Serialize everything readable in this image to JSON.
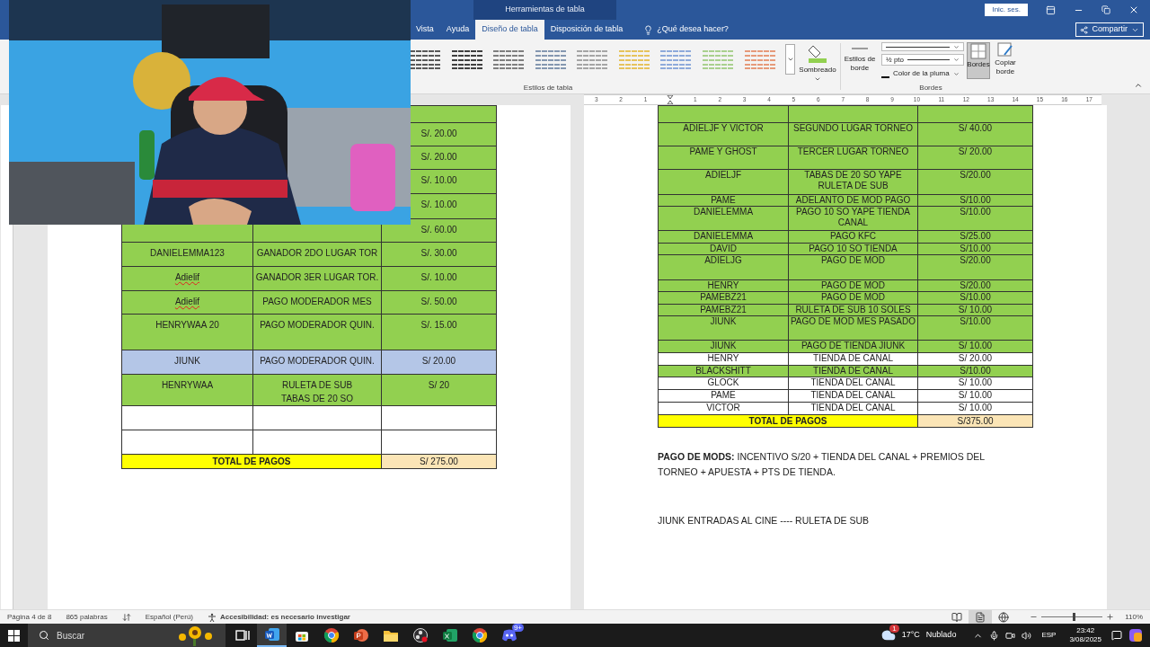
{
  "title_bar": {
    "context_label": "Herramientas de tabla",
    "sign_in": "Inic. ses."
  },
  "tabs": [
    {
      "label": "Vista",
      "selected": false
    },
    {
      "label": "Ayuda",
      "selected": false
    },
    {
      "label": "Diseño de tabla",
      "selected": true
    },
    {
      "label": "Disposición de tabla",
      "selected": false
    }
  ],
  "tell_me": "¿Qué desea hacer?",
  "share_button": "Compartir",
  "ribbon": {
    "table_styles": [
      {
        "color": "#595959"
      },
      {
        "color": "#404040"
      },
      {
        "color": "#7f7f7f"
      },
      {
        "color": "#8497b0"
      },
      {
        "color": "#a5a5a5"
      },
      {
        "color": "#e6c35c"
      },
      {
        "color": "#8eaadb"
      },
      {
        "color": "#a9d08e"
      },
      {
        "color": "#e69a7a"
      }
    ],
    "table_styles_label": "Estilos de tabla",
    "shading": "Sombreado",
    "border_styles": "Estilos de borde",
    "pen_weight": "½ pto",
    "pen_color": "Color de la pluma",
    "borders": {
      "label": "Bordes",
      "selected": true
    },
    "border_painter": "Copiar borde",
    "borders_group_label": "Bordes"
  },
  "ruler": {
    "left_labels": [
      "3",
      "2",
      "1"
    ],
    "right_labels": [
      "1",
      "2",
      "3",
      "4",
      "5",
      "6",
      "7",
      "8",
      "9",
      "10",
      "11",
      "12",
      "13",
      "14",
      "15",
      "16",
      "17"
    ]
  },
  "left_table": {
    "rows": [
      {
        "color": "#92d050",
        "cells": []
      },
      {
        "color": "#92d050",
        "cells": [
          null,
          null,
          "S/. 20.00"
        ]
      },
      {
        "color": "#92d050",
        "cells": [
          null,
          null,
          "S/. 20.00"
        ]
      },
      {
        "color": "#92d050",
        "cells": [
          null,
          null,
          "S/. 10.00"
        ]
      },
      {
        "color": "#92d050",
        "cells": [
          null,
          null,
          "S/. 10.00"
        ]
      },
      {
        "color": "#92d050",
        "cells": [
          null,
          null,
          "S/. 60.00"
        ]
      },
      {
        "color": "#92d050",
        "flagged": false,
        "cells": [
          "DANIELEMMA123",
          "GANADOR 2DO LUGAR TOR",
          "S/. 30.00"
        ]
      },
      {
        "color": "#92d050",
        "flagged": true,
        "cells": [
          "Adielif",
          "GANADOR 3ER LUGAR TOR.",
          "S/. 10.00"
        ]
      },
      {
        "color": "#92d050",
        "flagged": true,
        "cells": [
          "Adielif",
          "PAGO MODERADOR MES",
          "S/. 50.00"
        ]
      },
      {
        "color": "#92d050",
        "flagged": false,
        "cells": [
          "HENRYWAA 20",
          "PAGO MODERADOR QUIN.",
          "S/. 15.00"
        ]
      },
      {
        "color": "#b4c6e7",
        "flagged": false,
        "cells": [
          "JIUNK",
          "PAGO MODERADOR QUIN.",
          "S/ 20.00"
        ]
      },
      {
        "color": "#92d050",
        "flagged": false,
        "cells": [
          "HENRYWAA",
          "RULETA DE SUB\nTABAS DE 20 SO",
          "S/ 20"
        ]
      },
      {
        "color": "#ffffff",
        "cells": []
      },
      {
        "color": "#ffffff",
        "cells": []
      }
    ],
    "total_label": "TOTAL DE PAGOS",
    "total": "S/ 275.00"
  },
  "right_table": {
    "rows": [
      {
        "color": "#92d050",
        "cells": []
      },
      {
        "color": "#92d050",
        "cells": [
          "ADIELJF Y VICTOR",
          "SEGUNDO LUGAR TORNEO",
          "S/ 40.00"
        ]
      },
      {
        "color": "#92d050",
        "cells": [
          "PAME Y GHOST",
          "TERCER LUGAR TORNEO",
          "S/ 20.00"
        ]
      },
      {
        "color": "#92d050",
        "cells": [
          "ADIELJF",
          "TABAS DE 20 SO YAPE RULETA DE SUB",
          "S/20.00"
        ]
      },
      {
        "color": "#92d050",
        "cells": [
          "PAME",
          "ADELANTO DE MOD PAGO",
          "S/10.00"
        ]
      },
      {
        "color": "#92d050",
        "cells": [
          "DANIELEMMA",
          "PAGO 10 SO YAPE TIENDA CANAL",
          "S/10.00"
        ]
      },
      {
        "color": "#92d050",
        "cells": [
          "DANIELEMMA",
          "PAGO KFC",
          "S/25.00"
        ]
      },
      {
        "color": "#92d050",
        "cells": [
          "DAVID",
          "PAGO 10 SO TIENDA",
          "S/10.00"
        ]
      },
      {
        "color": "#92d050",
        "cells": [
          "ADIELJG",
          "PAGO DE MOD",
          "S/20.00"
        ]
      },
      {
        "color": "#92d050",
        "cells": [
          "HENRY",
          "PAGO DE MOD",
          "S/20.00"
        ]
      },
      {
        "color": "#92d050",
        "cells": [
          "PAMEBZ21",
          "PAGO DE MOD",
          "S/10.00"
        ]
      },
      {
        "color": "#92d050",
        "cells": [
          "PAMEBZ21",
          "RULETA DE SUB 10 SOLES",
          "S/ 10.00"
        ]
      },
      {
        "color": "#92d050",
        "cells": [
          "JIUNK",
          "PAGO DE MOD MES PASADO",
          "S/10.00"
        ]
      },
      {
        "color": "#92d050",
        "cells": [
          "JIUNK",
          "PAGO DE TIENDA JIUNK",
          "S/ 10.00"
        ]
      },
      {
        "color": "#ffffff",
        "cells": [
          "HENRY",
          "TIENDA DE CANAL",
          "S/ 20.00"
        ]
      },
      {
        "color": "#92d050",
        "cells": [
          "BLACKSHITT",
          "TIENDA DE CANAL",
          "S/10.00"
        ]
      },
      {
        "color": "#ffffff",
        "cells": [
          "GLOCK",
          "TIENDA DEL CANAL",
          "S/ 10.00"
        ]
      },
      {
        "color": "#ffffff",
        "cells": [
          "PAME",
          "TIENDA DEL CANAL",
          "S/ 10.00"
        ]
      },
      {
        "color": "#ffffff",
        "cells": [
          "VICTOR",
          "TIENDA DEL CANAL",
          "S/ 10.00"
        ]
      }
    ],
    "total_label": "TOTAL DE PAGOS",
    "total": "S/375.00"
  },
  "notes": [
    "**PAGO DE MODS:** INCENTIVO S/20 + TIENDA DEL CANAL + PREMIOS DEL TORNEO + APUESTA + PTS DE TIENDA.",
    "JIUNK ENTRADAS AL CINE ---- RULETA DE SUB"
  ],
  "status_bar": {
    "page": "Página 4 de 8",
    "words": "865 palabras",
    "language": "Español (Perú)",
    "accessibility": "Accesibilidad: es necesario investigar",
    "views": [
      {
        "kind": "read",
        "selected": false
      },
      {
        "kind": "print",
        "selected": true
      },
      {
        "kind": "web",
        "selected": false
      }
    ],
    "zoom_slider": {
      "level": 0.52
    },
    "zoom": "110%"
  },
  "taskbar": {
    "search_placeholder": "Buscar",
    "apps": [
      {
        "kind": "taskview",
        "selected": false
      },
      {
        "kind": "word",
        "selected": true
      },
      {
        "kind": "store",
        "selected": false
      },
      {
        "kind": "chrome",
        "selected": false
      },
      {
        "kind": "powerpoint",
        "selected": false
      },
      {
        "kind": "explorer",
        "selected": false
      },
      {
        "kind": "obs",
        "selected": false
      },
      {
        "kind": "excel",
        "selected": false
      },
      {
        "kind": "chrome",
        "selected": false
      },
      {
        "kind": "discord",
        "selected": false,
        "badge": "9+"
      }
    ],
    "weather_badge": "1",
    "temperature": "17°C",
    "weather": "Nublado",
    "language": "ESP",
    "time": "23:42",
    "date": "3/08/2025"
  }
}
